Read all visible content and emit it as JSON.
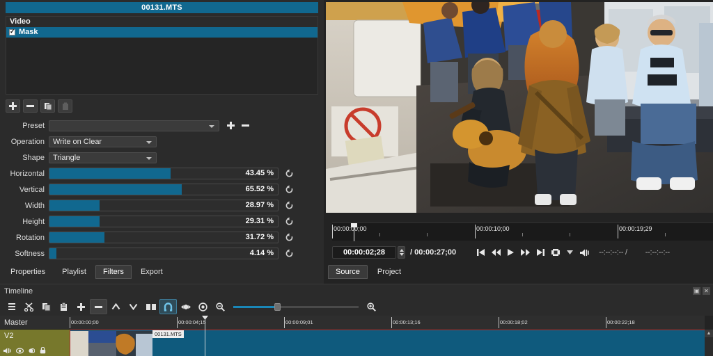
{
  "filter_panel": {
    "title": "00131.MTS",
    "list_header": "Video",
    "filters": [
      {
        "name": "Mask",
        "checked": true,
        "selected": true
      }
    ],
    "buttons": [
      {
        "name": "add-filter-button",
        "icon": "plus-icon",
        "label": "+",
        "enabled": true
      },
      {
        "name": "remove-filter-button",
        "icon": "minus-icon",
        "label": "−",
        "enabled": true
      },
      {
        "name": "copy-filters-button",
        "icon": "copy-icon",
        "label": "",
        "enabled": true
      },
      {
        "name": "paste-filters-button",
        "icon": "paste-icon",
        "label": "",
        "enabled": false
      }
    ],
    "preset": {
      "label": "Preset",
      "value": "",
      "add_label": "+",
      "remove_label": "−"
    },
    "params": [
      {
        "label": "Operation",
        "type": "combo",
        "value": "Write on Clear",
        "revert": "↺"
      },
      {
        "label": "Shape",
        "type": "combo",
        "value": "Triangle",
        "revert": "↺"
      },
      {
        "label": "Horizontal",
        "type": "slider",
        "value": "43.45 %",
        "percent": 53,
        "revert": "↺"
      },
      {
        "label": "Vertical",
        "type": "slider",
        "value": "65.52 %",
        "percent": 58,
        "revert": "↺"
      },
      {
        "label": "Width",
        "type": "slider",
        "value": "28.97 %",
        "percent": 22,
        "revert": "↺"
      },
      {
        "label": "Height",
        "type": "slider",
        "value": "29.31 %",
        "percent": 22,
        "revert": "↺"
      },
      {
        "label": "Rotation",
        "type": "slider",
        "value": "31.72 %",
        "percent": 24,
        "revert": "↺"
      },
      {
        "label": "Softness",
        "type": "slider",
        "value": "4.14 %",
        "percent": 3,
        "revert": "↺"
      }
    ],
    "tabs": [
      {
        "label": "Properties",
        "active": false
      },
      {
        "label": "Playlist",
        "active": false
      },
      {
        "label": "Filters",
        "active": true
      },
      {
        "label": "Export",
        "active": false
      }
    ]
  },
  "player": {
    "ruler_labels": [
      "00:00:00;00",
      "00:00:10;00",
      "00:00:19;29"
    ],
    "playhead_percent": 5.6,
    "current_time": "00:00:02;28",
    "separator": "/",
    "total_time": "00:00:27;00",
    "transport": [
      {
        "name": "skip-to-start-button",
        "icon": "skip-previous-icon"
      },
      {
        "name": "rewind-button",
        "icon": "rewind-icon"
      },
      {
        "name": "play-button",
        "icon": "play-icon"
      },
      {
        "name": "fast-forward-button",
        "icon": "fast-forward-icon"
      },
      {
        "name": "skip-to-end-button",
        "icon": "skip-next-icon"
      },
      {
        "name": "grab-frame-button",
        "icon": "grab-frame-icon"
      },
      {
        "name": "more-options-button",
        "icon": "chevron-down-icon"
      },
      {
        "name": "volume-button",
        "icon": "volume-icon"
      }
    ],
    "in_out": {
      "selected_duration": "--:--:--:-- /",
      "total_selected": "--:--:--:--"
    },
    "tabs": [
      {
        "label": "Source",
        "active": true
      },
      {
        "label": "Project",
        "active": false
      }
    ]
  },
  "timeline": {
    "title": "Timeline",
    "window_buttons": [
      {
        "name": "float-panel-button",
        "glyph": "▣"
      },
      {
        "name": "close-panel-button",
        "glyph": "✕"
      }
    ],
    "tools": [
      {
        "name": "timeline-menu-button",
        "icon": "hamburger-menu-icon",
        "state": "normal"
      },
      {
        "name": "cut-button",
        "icon": "scissors-icon",
        "state": "normal"
      },
      {
        "name": "copy-button",
        "icon": "copy-icon",
        "state": "normal"
      },
      {
        "name": "paste-button",
        "icon": "paste-icon",
        "state": "normal"
      },
      {
        "name": "append-button",
        "icon": "plus-icon",
        "state": "normal"
      },
      {
        "name": "ripple-delete-button",
        "icon": "minus-icon",
        "state": "pressed"
      },
      {
        "name": "lift-button",
        "icon": "chevron-up-icon",
        "state": "normal"
      },
      {
        "name": "overwrite-button",
        "icon": "chevron-down-icon",
        "state": "normal"
      },
      {
        "name": "split-button",
        "icon": "split-icon",
        "state": "normal"
      },
      {
        "name": "snap-toggle-button",
        "icon": "magnet-icon",
        "state": "on"
      },
      {
        "name": "scrub-while-dragging-button",
        "icon": "scrub-icon",
        "state": "normal"
      },
      {
        "name": "ripple-all-tracks-button",
        "icon": "target-icon",
        "state": "normal"
      },
      {
        "name": "zoom-timeline-out-button",
        "icon": "zoom-out-icon",
        "state": "normal"
      }
    ],
    "zoom": {
      "percent": 35,
      "zoom_in_icon": "zoom-in-icon"
    },
    "tracks": [
      {
        "name": "Master",
        "type": "master"
      },
      {
        "name": "V2",
        "type": "video",
        "selected": true,
        "icons": [
          "mute-icon",
          "hide-icon",
          "lock-icon",
          "blend-icon"
        ]
      }
    ],
    "ruler_labels": [
      "00:00:00;00",
      "00:00:04;15",
      "00:00:09;01",
      "00:00:13;16",
      "00:00:18;02",
      "00:00:22;18"
    ],
    "playhead_percent": 16.8,
    "clip": {
      "name": "00131.MTS"
    }
  }
}
